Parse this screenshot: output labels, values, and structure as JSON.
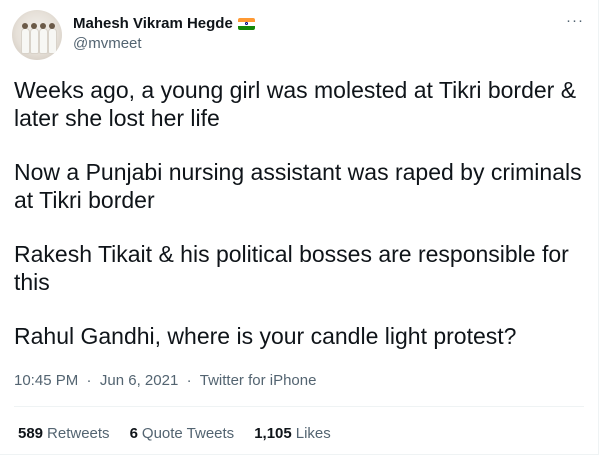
{
  "author": {
    "display_name": "Mahesh Vikram Hegde",
    "handle": "@mvmeet",
    "badge_icon": "india-flag-icon"
  },
  "more_icon": "more-icon",
  "tweet": {
    "paragraphs": [
      "Weeks ago, a young girl was molested at Tikri border & later she lost her life",
      "Now a Punjabi nursing assistant was raped by criminals at Tikri border",
      "Rakesh Tikait & his political bosses are responsible for this",
      "Rahul Gandhi, where is your candle light protest?"
    ]
  },
  "meta": {
    "time": "10:45 PM",
    "separator": "·",
    "date": "Jun 6, 2021",
    "source": "Twitter for iPhone"
  },
  "stats": {
    "retweets_count": "589",
    "retweets_label": "Retweets",
    "quotes_count": "6",
    "quotes_label": "Quote Tweets",
    "likes_count": "1,105",
    "likes_label": "Likes"
  },
  "colors": {
    "text": "#0f1419",
    "secondary": "#536471",
    "divider": "#eff3f4"
  }
}
